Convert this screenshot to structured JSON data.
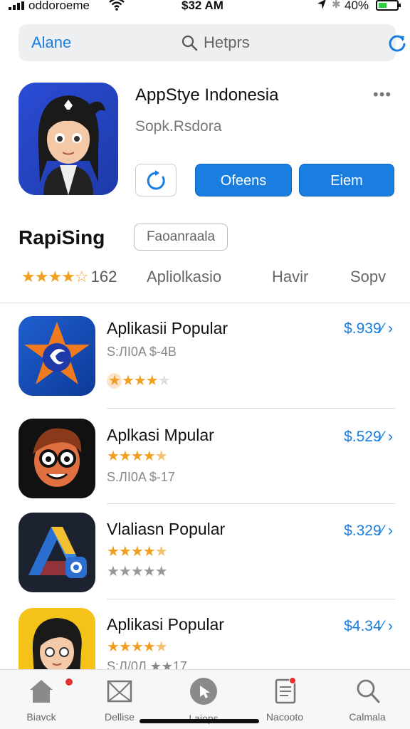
{
  "status_bar": {
    "carrier": "oddoroeme",
    "time": "$32 AM",
    "battery_pct": "40%"
  },
  "search": {
    "back_label": "Alane",
    "query": "Hetprs"
  },
  "app": {
    "title": "AppStye Indonesia",
    "subtitle": "Sopk.Rsdora",
    "open_label": "Ofeens",
    "item_label": "Eiem"
  },
  "section": {
    "title": "RapiSing",
    "chip": "Faoanraala",
    "rating_stars": "★★★★☆",
    "rating_count": "162",
    "tabs": [
      "Apliolkasio",
      "Havir",
      "Sopv"
    ]
  },
  "list": [
    {
      "name": "Aplikasii Popular",
      "price": "$.939⁄ ›",
      "meta": "S:ЛI0A $-4B",
      "stars": 3.5
    },
    {
      "name": "Aplkasi Mpular",
      "price": "$.529⁄ ›",
      "meta": "S.ЛI0A $-17",
      "stars": 4.5
    },
    {
      "name": "Vlaliasn Popular",
      "price": "$.329⁄ ›",
      "meta": "",
      "stars": 4.5
    },
    {
      "name": "Aplikasi Popular",
      "price": "$4.34⁄ ›",
      "meta": "S:Л/0Л ★★17",
      "stars": 4.5
    }
  ],
  "tab_bar": {
    "tabs": [
      "Biavck",
      "Dellise",
      "Laiops",
      "Nacooto",
      "Calmala"
    ]
  },
  "colors": {
    "accent": "#1a7ee0",
    "star": "#f0a020",
    "badge": "#e53030"
  }
}
